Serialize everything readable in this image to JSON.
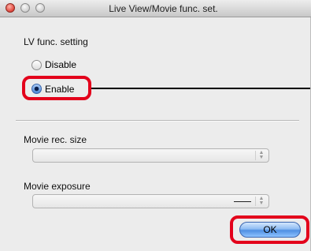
{
  "window": {
    "title": "Live View/Movie func. set."
  },
  "lv_func": {
    "label": "LV func. setting",
    "options": [
      {
        "label": "Disable",
        "checked": false
      },
      {
        "label": "Enable",
        "checked": true
      }
    ]
  },
  "movie_rec_size": {
    "label": "Movie rec. size",
    "value": ""
  },
  "movie_exposure": {
    "label": "Movie exposure",
    "value": ""
  },
  "footer": {
    "ok_label": "OK"
  },
  "annotation_color": "#e3001b"
}
